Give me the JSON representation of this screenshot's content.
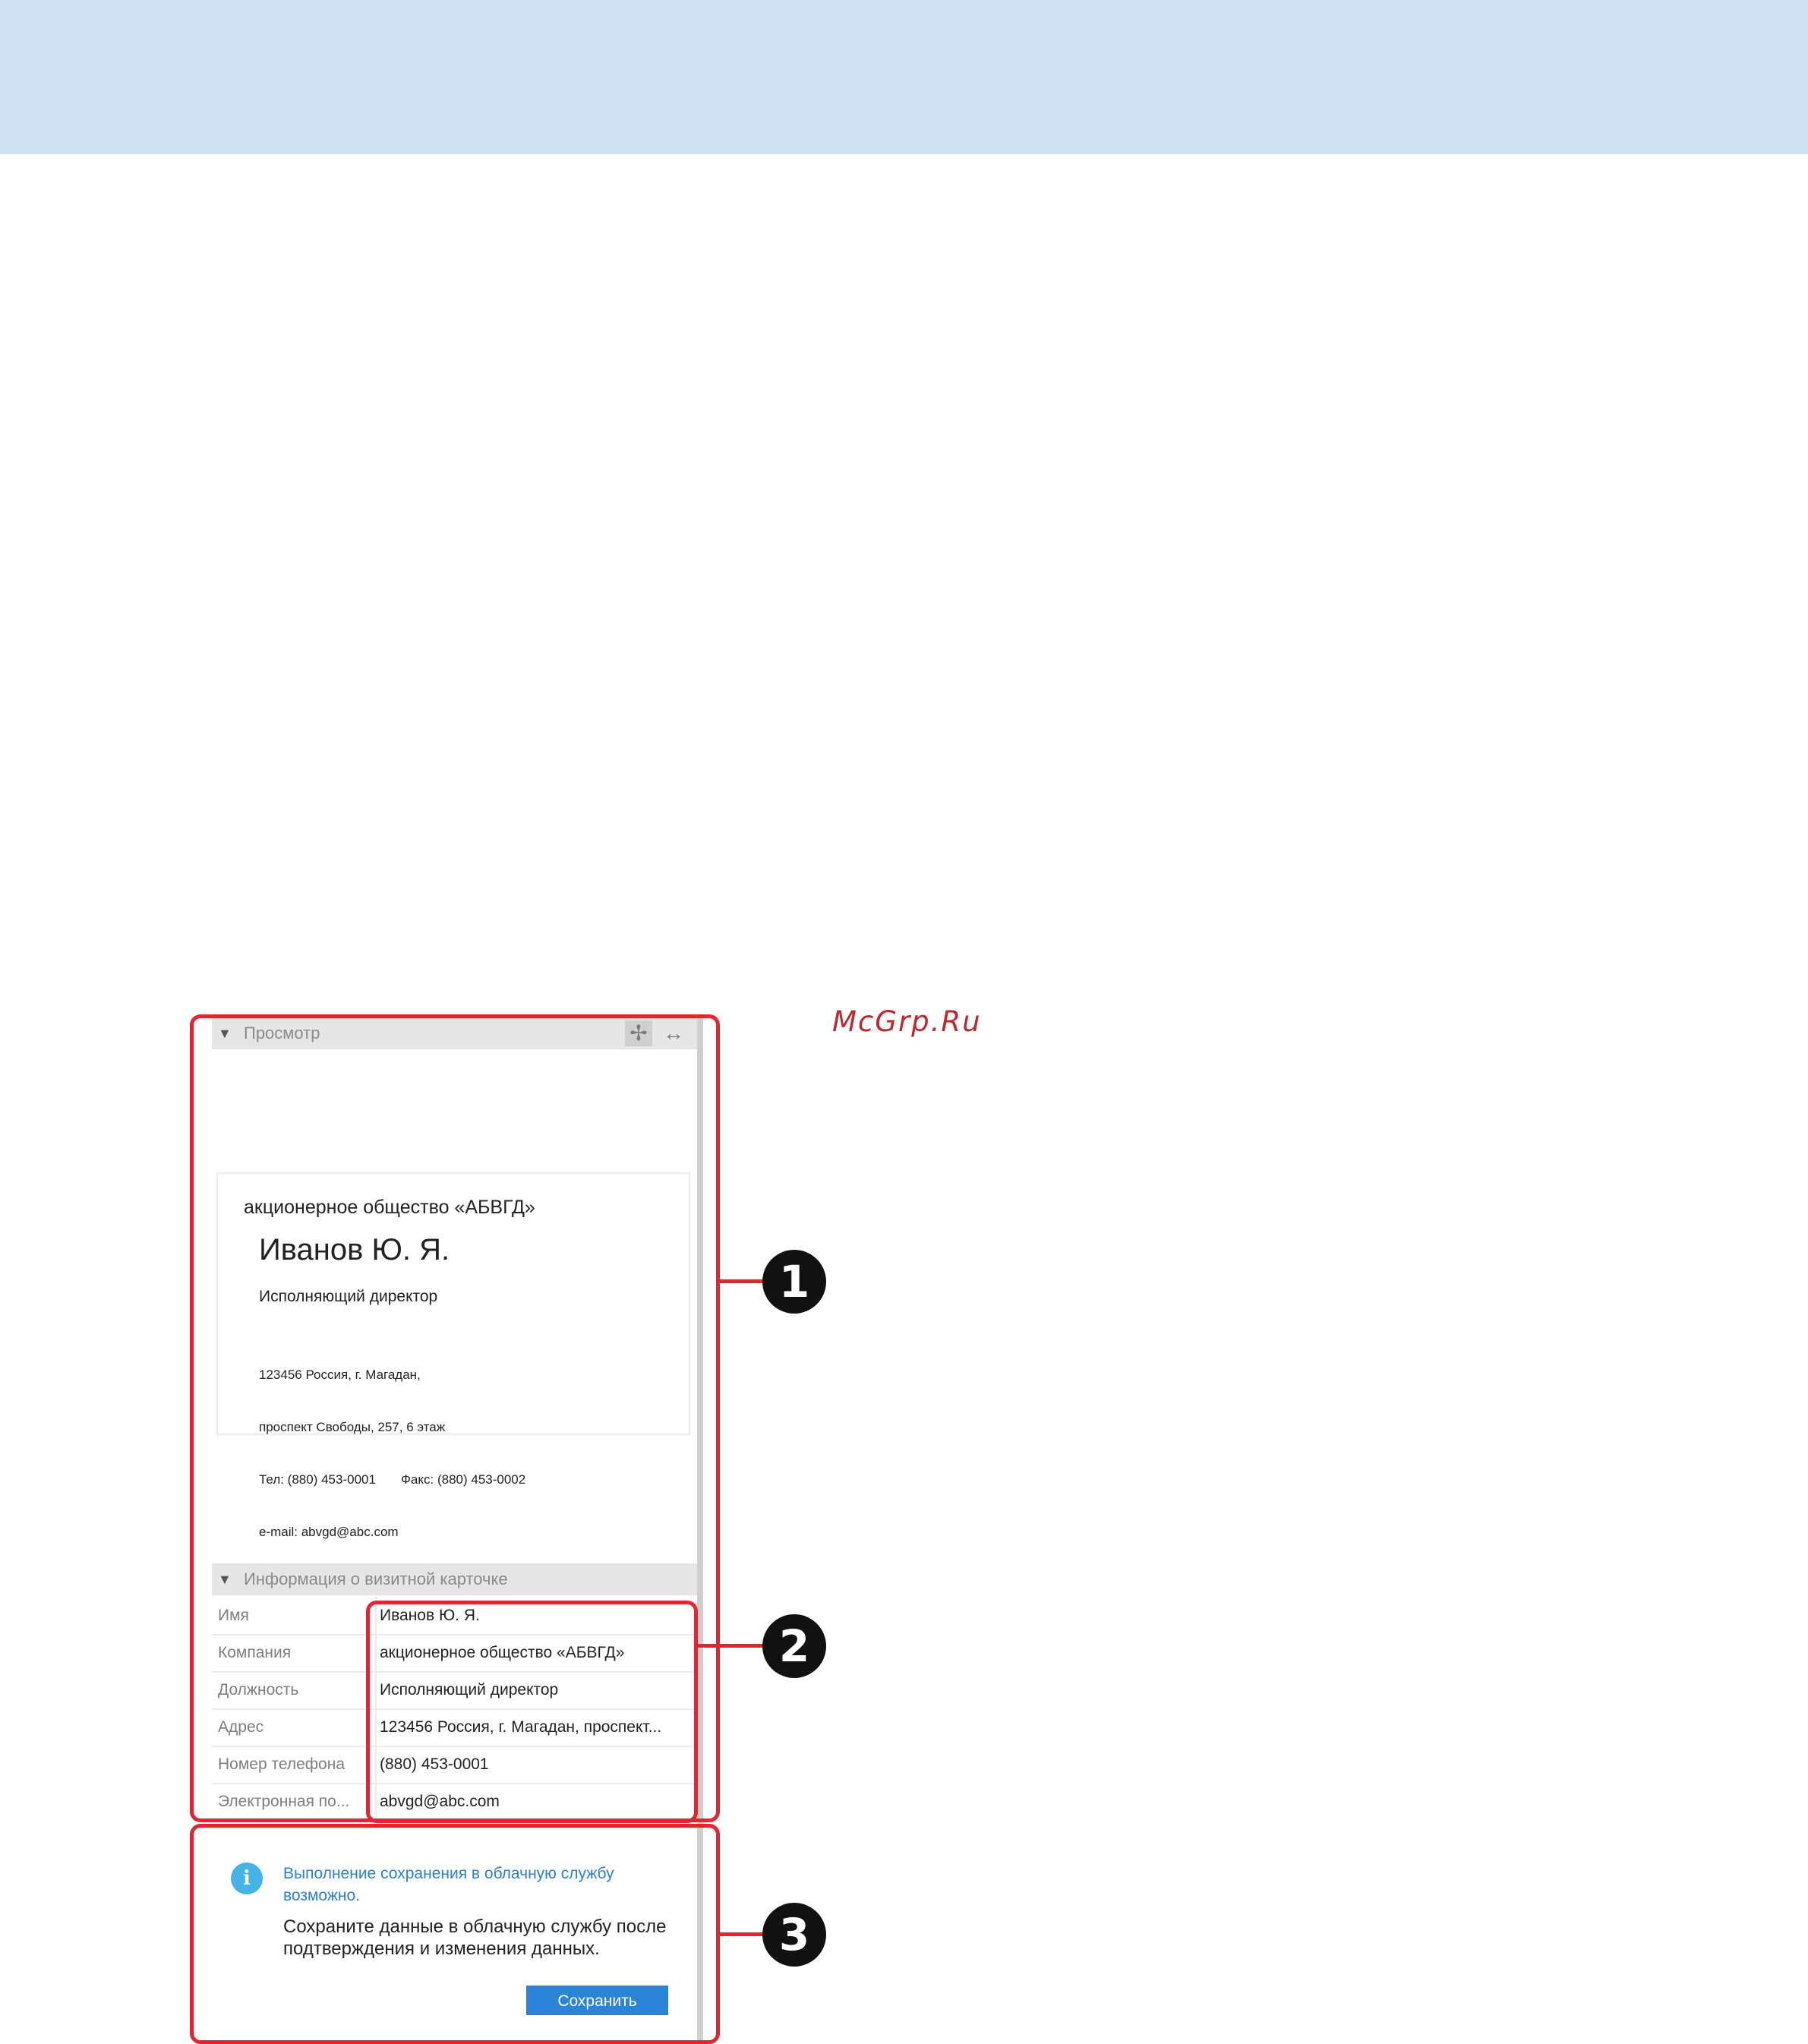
{
  "watermark": "McGrp.Ru",
  "preview": {
    "title": "Просмотр",
    "card": {
      "company": "акционерное общество «АБВГД»",
      "name": "Иванов Ю. Я.",
      "position": "Исполняющий директор",
      "address_line1": "123456 Россия, г. Магадан,",
      "address_line2": "проспект Свободы, 257, 6 этаж",
      "phone_fax": "Тел: (880) 453-0001       Факс: (880) 453-0002",
      "email": "e-mail: abvgd@abc.com"
    }
  },
  "info": {
    "title": "Информация о визитной карточке",
    "rows": [
      {
        "label": "Имя",
        "value": "Иванов Ю. Я."
      },
      {
        "label": "Компания",
        "value": "акционерное общество «АБВГД»"
      },
      {
        "label": "Должность",
        "value": "Исполняющий директор"
      },
      {
        "label": "Адрес",
        "value": "123456 Россия, г. Магадан, проспект..."
      },
      {
        "label": "Номер телефона",
        "value": "(880) 453-0001"
      },
      {
        "label": "Электронная по...",
        "value": "abvgd@abc.com"
      }
    ]
  },
  "notification": {
    "icon": "info-icon",
    "message_primary": "Выполнение сохранения в облачную службу возможно.",
    "message_secondary": "Сохраните данные в облачную службу после подтверждения и изменения данных.",
    "save_label": "Сохранить"
  },
  "callouts": [
    "1",
    "2",
    "3"
  ],
  "colors": {
    "banner": "#cfe0f3",
    "annotation": "#e8232f",
    "accent": "#2c84d8"
  }
}
